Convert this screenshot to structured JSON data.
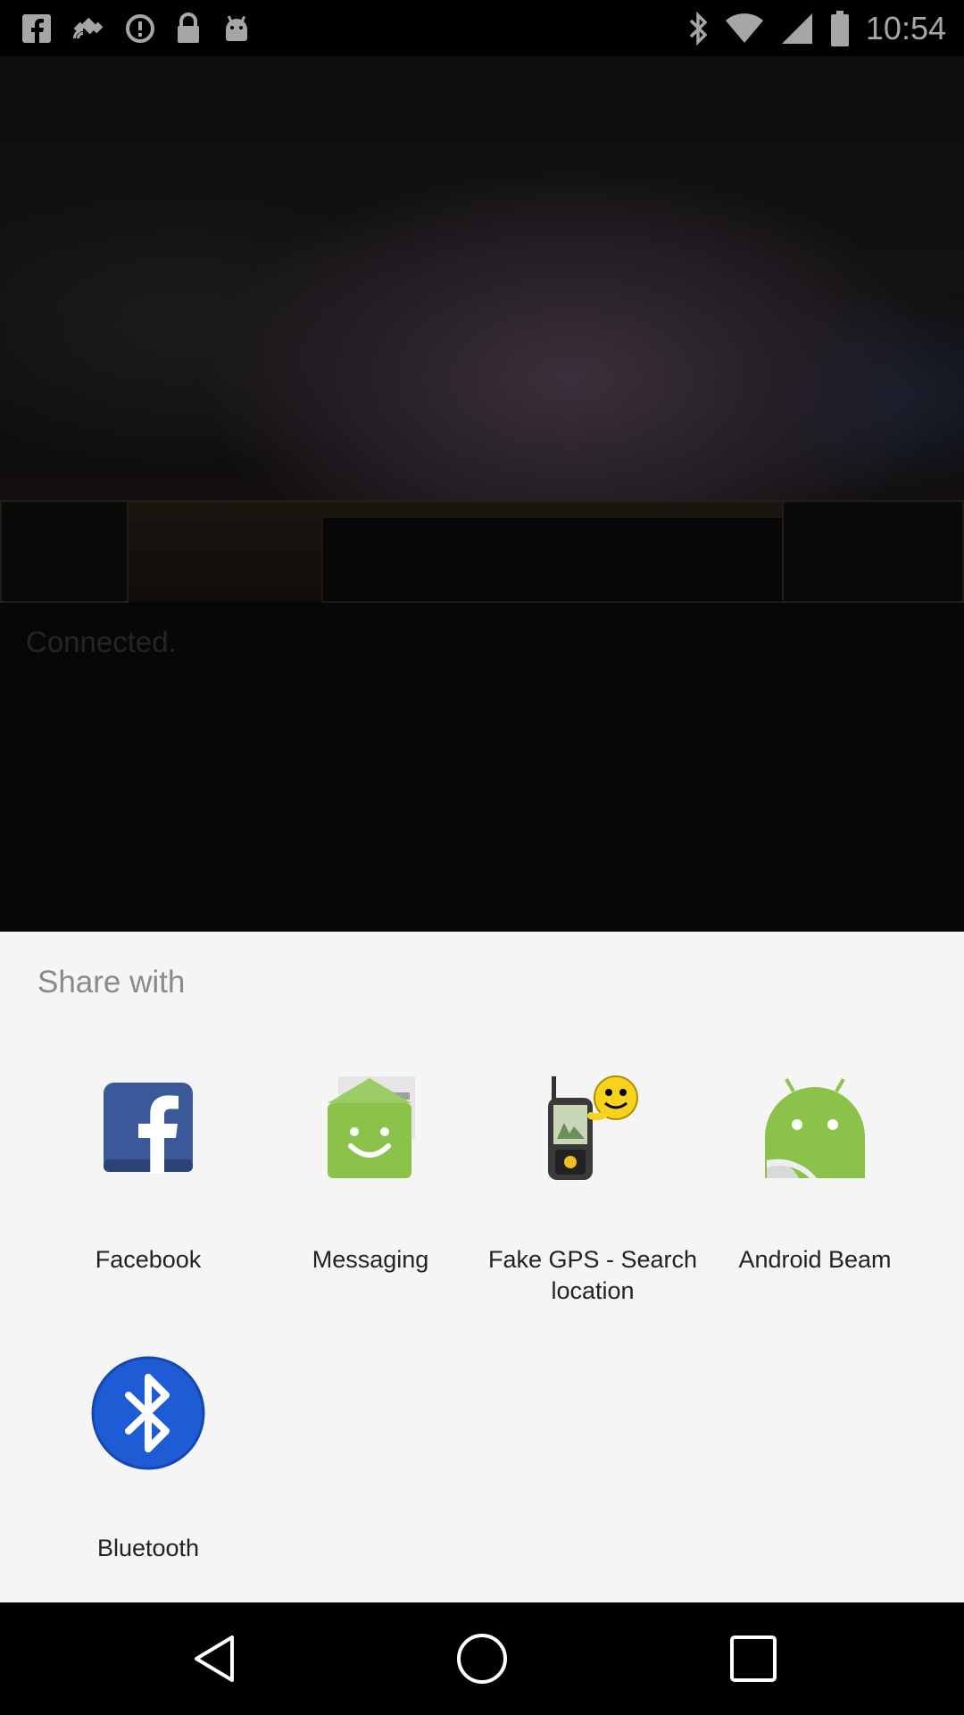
{
  "status_bar": {
    "time": "10:54",
    "left_icons": [
      "facebook-icon",
      "gps-satellite-icon",
      "alert-circle-icon",
      "lock-icon",
      "android-debug-icon"
    ],
    "right_icons": [
      "bluetooth-icon",
      "wifi-icon",
      "signal-icon",
      "battery-icon"
    ]
  },
  "background_app": {
    "status_text": "Connected."
  },
  "share_sheet": {
    "title": "Share with",
    "apps": [
      {
        "label": "Facebook",
        "icon": "facebook-icon"
      },
      {
        "label": "Messaging",
        "icon": "messaging-icon"
      },
      {
        "label": "Fake GPS - Search location",
        "icon": "fake-gps-icon"
      },
      {
        "label": "Android Beam",
        "icon": "android-beam-icon"
      },
      {
        "label": "Bluetooth",
        "icon": "bluetooth-icon"
      }
    ]
  },
  "nav_bar": {
    "buttons": [
      "back-icon",
      "home-icon",
      "recents-icon"
    ]
  },
  "colors": {
    "facebook_blue": "#3b5998",
    "messaging_green": "#8bc34a",
    "android_green": "#8bc34a",
    "bluetooth_blue": "#1e5cd6",
    "sheet_bg": "#f5f5f5"
  }
}
